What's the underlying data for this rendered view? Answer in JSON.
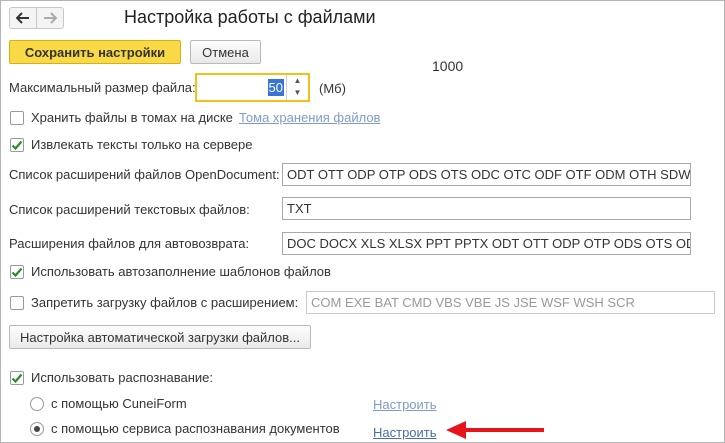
{
  "window": {
    "title": "Настройка работы с файлами",
    "nav_back_icon": "arrow-left-icon",
    "nav_forward_icon": "arrow-right-icon"
  },
  "toolbar": {
    "save_label": "Сохранить настройки",
    "cancel_label": "Отмена",
    "floating_value": "1000"
  },
  "max_file_size": {
    "label": "Максимальный размер файла:",
    "value": "50",
    "unit": "(Мб)"
  },
  "store_in_volumes": {
    "label": "Хранить файлы в томах на диске",
    "checked": false,
    "link": "Тома хранения файлов"
  },
  "extract_on_server": {
    "label": "Извлекать тексты только на сервере",
    "checked": true
  },
  "opendocument_ext": {
    "label": "Список расширений файлов OpenDocument:",
    "value": "ODT OTT ODP OTP ODS OTS ODC OTC ODF OTF ODM OTH SDW"
  },
  "text_ext": {
    "label": "Список расширений текстовых файлов:",
    "value": "TXT"
  },
  "autoreturn_ext": {
    "label": "Расширения файлов для автовозврата:",
    "value": "DOC DOCX XLS XLSX PPT PPTX ODT OTT ODP OTP ODS OTS ODC"
  },
  "autofill_templates": {
    "label": "Использовать автозаполнение шаблонов файлов",
    "checked": true
  },
  "forbid_upload": {
    "label": "Запретить загрузку файлов с расширением:",
    "checked": false,
    "value": "COM EXE BAT CMD VBS VBE JS JSE WSF WSH SCR"
  },
  "auto_upload_button": "Настройка автоматической загрузки файлов...",
  "recognition": {
    "label": "Использовать распознавание:",
    "checked": true,
    "options": [
      {
        "label": "с помощью CuneiForm",
        "selected": false,
        "link": "Настроить"
      },
      {
        "label": "с помощью сервиса распознавания документов",
        "selected": true,
        "link": "Настроить"
      }
    ]
  },
  "colors": {
    "primary_button": "#fad946",
    "focus_border": "#f2c21b",
    "link": "#4a6ea9",
    "annotation_arrow": "#e8141c"
  }
}
